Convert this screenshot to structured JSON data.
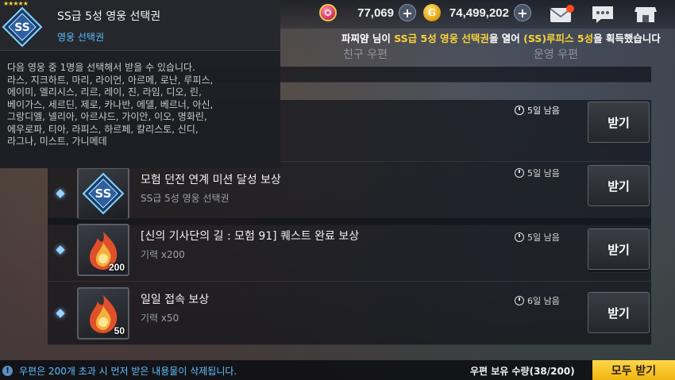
{
  "currency": {
    "gems": "77,069",
    "gold": "74,499,202",
    "gold_icon_letter": "G"
  },
  "notice": {
    "player": "파찌얌",
    "text1": " 님이 ",
    "item": "SS급 5성 영웅 선택권",
    "text2": "을 열어 ",
    "hero": "(SS)루피스 5성",
    "text3": "을 획득했습니다"
  },
  "tabs": [
    "친구 우편",
    "운영 우편"
  ],
  "tooltip": {
    "title": "SS급 5성 영웅 선택권",
    "category": "영웅 선택권",
    "body_lines": [
      "다음 영웅 중 1명을 선택해서 받을 수 있습니다.",
      "라스, 지크하트, 마리, 라이언, 아르메, 로난, 루피스,",
      "에이미, 엘리시스, 리르, 레이, 진, 라임, 디오, 린,",
      "베이가스, 세르딘, 제로, 카나반, 에델, 베르너, 아신,",
      "그랑디엘, 넬리아, 아르샤드, 가이안, 이오, 명화린,",
      "에우로파, 티아, 라피스, 하르페, 칼리스토, 신디,",
      "라그나, 미스트, 가니메데"
    ],
    "stars": "★★★★★",
    "icon_text": "SS"
  },
  "mail_rows": [
    {
      "title": "",
      "subtitle": "",
      "time": "5일 남음",
      "button": "받기",
      "count": "",
      "icon": "ss-ticket-icon"
    },
    {
      "title": "모험 던전 연계 미션 달성 보상",
      "subtitle": "SS급 5성 영웅 선택권",
      "time": "5일 남음",
      "button": "받기",
      "count": "",
      "icon": "ss-ticket-icon"
    },
    {
      "title": "[신의 기사단의 길 : 모험 91] 퀘스트 완료 보상",
      "subtitle": "기력 x200",
      "time": "5일 남음",
      "button": "받기",
      "count": "200",
      "icon": "stamina-flame-icon"
    },
    {
      "title": "일일 접속 보상",
      "subtitle": "기력 x50",
      "time": "6일 남음",
      "button": "받기",
      "count": "50",
      "icon": "stamina-flame-icon"
    }
  ],
  "bottom": {
    "warning": "우편은 200개 초과 시 먼저 받은 내용물이 삭제됩니다.",
    "capacity": "우편 보유 수량(38/200)",
    "claim_all": "모두 받기"
  },
  "colors": {
    "accent_gold": "#f7d33a",
    "link_blue": "#5ec0ff",
    "claim_all_bg": "#ffd64a"
  }
}
